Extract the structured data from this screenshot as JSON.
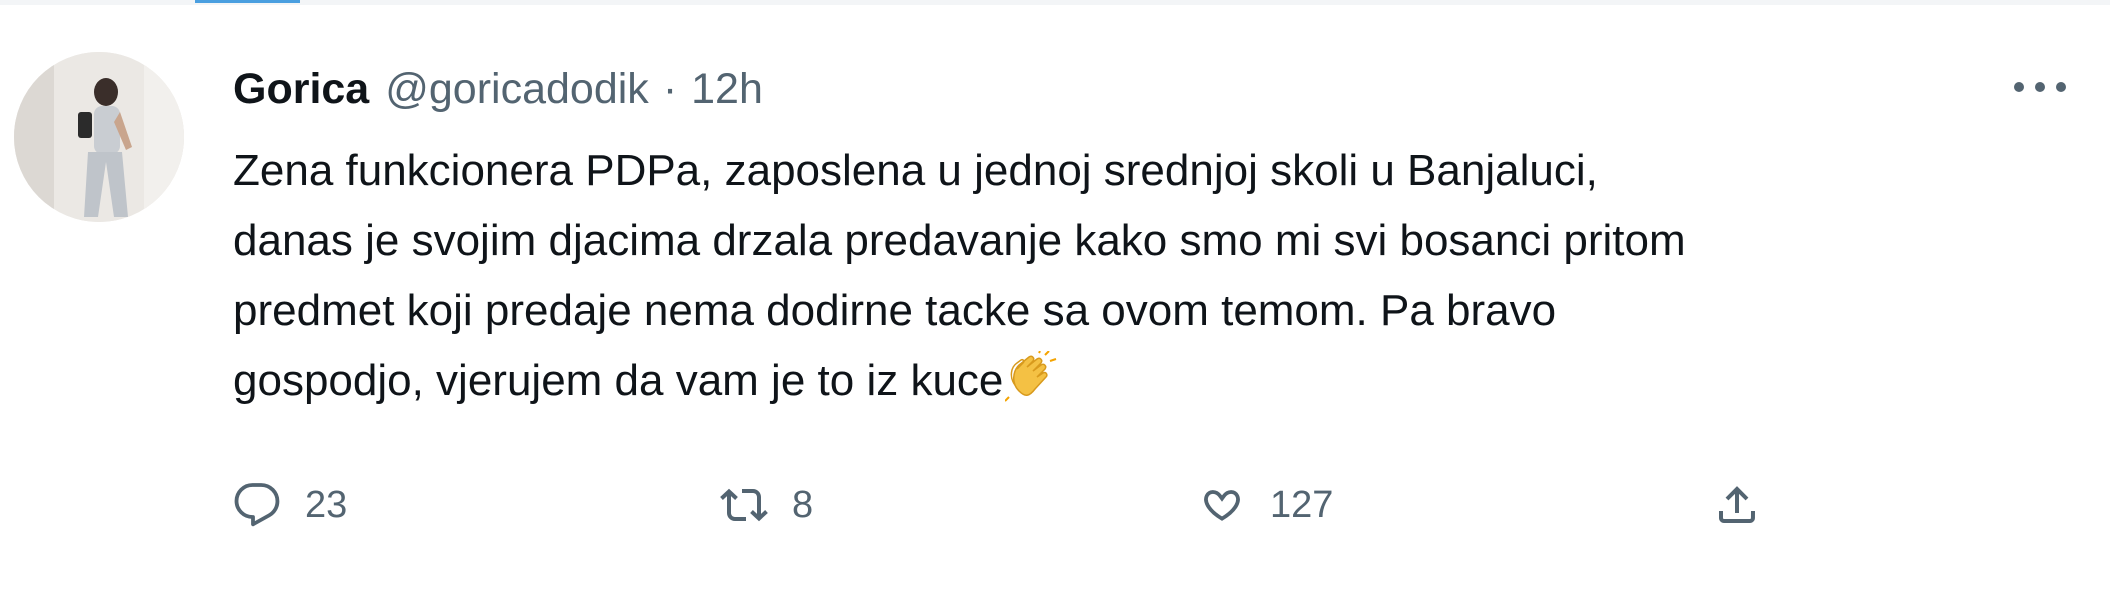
{
  "tweet": {
    "author": {
      "display_name": "Gorica",
      "handle": "@goricadodik",
      "separator": "·",
      "time": "12h"
    },
    "text_lines": [
      "Zena funkcionera PDPa, zaposlena u jednoj srednjoj skoli u Banjaluci,",
      "danas je svojim djacima drzala predavanje kako smo mi svi bosanci pritom",
      "predmet koji predaje nema dodirne tacke sa ovom temom. Pa bravo",
      "gospodjo, vjerujem da vam je to iz kuce"
    ],
    "emoji": "clapping-hands",
    "stats": {
      "replies": "23",
      "retweets": "8",
      "likes": "127"
    },
    "icons": {
      "more": "more-horizontal-icon",
      "reply": "reply-icon",
      "retweet": "retweet-icon",
      "like": "heart-icon",
      "share": "share-icon"
    },
    "colors": {
      "text": "#0f1419",
      "secondary": "#536471",
      "accent": "#4a9fe0"
    }
  }
}
